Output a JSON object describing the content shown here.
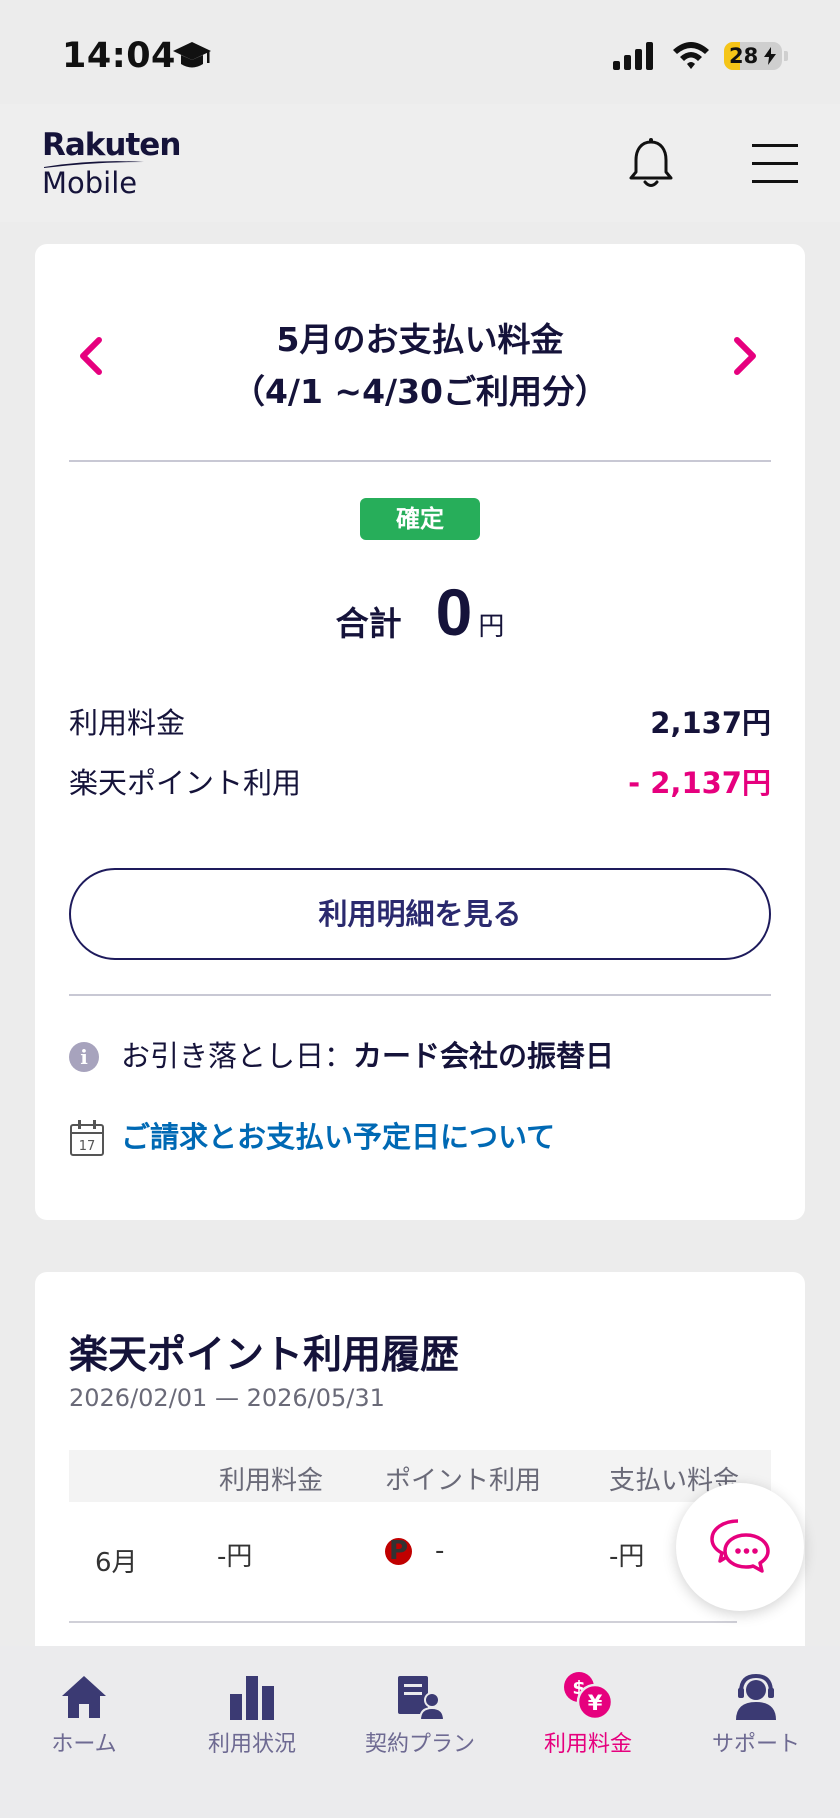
{
  "status_bar": {
    "time": "14:04",
    "battery": "28"
  },
  "header": {
    "logo_line1": "Rakuten",
    "logo_line2": "Mobile"
  },
  "billing": {
    "title_line1": "5月のお支払い料金",
    "title_line2": "（4/1 ~4/30ご利用分）",
    "status_badge": "確定",
    "total_label": "合計",
    "total_amount": "0",
    "total_unit": "円",
    "usage_fee_label": "利用料金",
    "usage_fee_value": "2,137円",
    "points_label": "楽天ポイント利用",
    "points_value": "- 2,137円",
    "detail_button": "利用明細を見る",
    "debit_label": "お引き落とし日：",
    "debit_value": "カード会社の振替日",
    "schedule_link": "ご請求とお支払い予定日について",
    "calendar_day": "17"
  },
  "history": {
    "title": "楽天ポイント利用履歴",
    "range": "2026/02/01 — 2026/05/31",
    "columns": [
      "利用料金",
      "ポイント利用",
      "支払い料金"
    ],
    "rows": [
      {
        "month": "6月",
        "fee": "-円",
        "points": "-",
        "paid": "-円"
      }
    ]
  },
  "bottom_nav": {
    "items": [
      {
        "label": "ホーム",
        "icon": "home-icon"
      },
      {
        "label": "利用状況",
        "icon": "bar-chart-icon"
      },
      {
        "label": "契約プラン",
        "icon": "contract-icon"
      },
      {
        "label": "利用料金",
        "icon": "billing-icon"
      },
      {
        "label": "サポート",
        "icon": "support-icon"
      }
    ],
    "active_index": 3
  },
  "colors": {
    "accent": "#e6007e",
    "navy": "#15133a",
    "confirmed": "#27ae5a",
    "link": "#0069b4"
  }
}
